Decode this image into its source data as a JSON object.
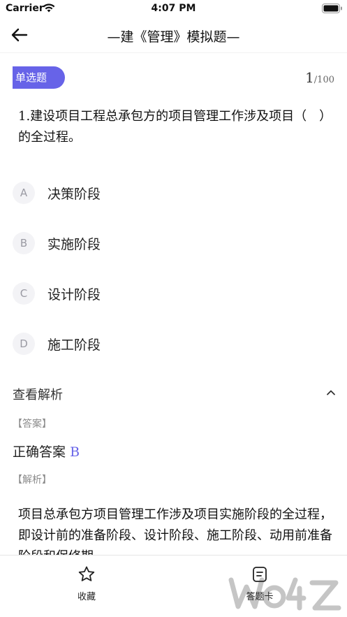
{
  "status_bar": {
    "carrier": "Carrier",
    "time": "4:07 PM"
  },
  "nav": {
    "title": "—建《管理》模拟题—"
  },
  "question": {
    "type_label": "单选题",
    "current": "1",
    "total": "/100",
    "number": "1.",
    "text": "建设项目工程总承包方的项目管理工作涉及项目（　）的全过程。"
  },
  "options": [
    {
      "letter": "A",
      "text": "决策阶段"
    },
    {
      "letter": "B",
      "text": "实施阶段"
    },
    {
      "letter": "C",
      "text": "设计阶段"
    },
    {
      "letter": "D",
      "text": "施工阶段"
    }
  ],
  "analysis": {
    "toggle_label": "查看解析",
    "answer_tag": "【答案】",
    "correct_answer_label": "正确答案",
    "correct_answer": "B",
    "explanation_tag": "【解析】",
    "explanation": "项目总承包方项目管理工作涉及项目实施阶段的全过程，即设计前的准备阶段、设计阶段、施工阶段、动用前准备阶段和保修期。"
  },
  "tab_bar": {
    "favorite_label": "收藏",
    "answer_card_label": "答题卡"
  },
  "colors": {
    "accent": "#6763e8",
    "option_circle": "#f3f3f6"
  }
}
